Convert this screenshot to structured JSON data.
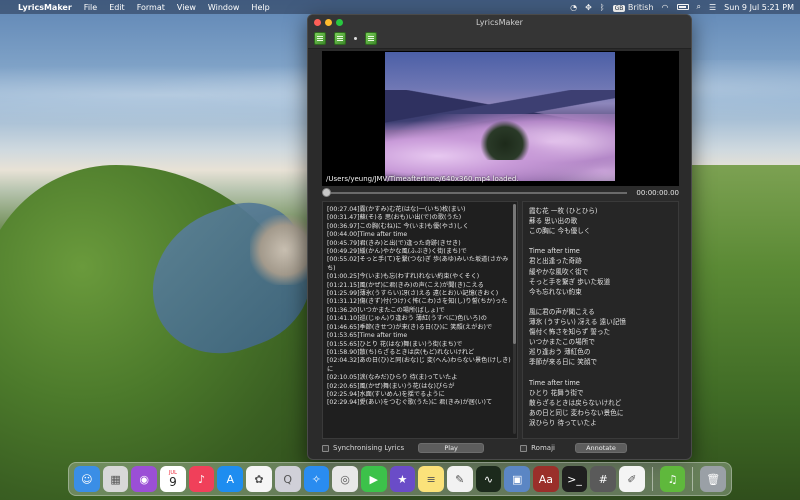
{
  "menubar": {
    "app_name": "LyricsMaker",
    "menus": [
      "File",
      "Edit",
      "Format",
      "View",
      "Window",
      "Help"
    ],
    "input_source": "British",
    "keyboard_badge": "GB",
    "date_time": "Sun 9 Jul  5:21 PM"
  },
  "window": {
    "title": "LyricsMaker",
    "status": "/Users/yeung/JMV/Timeaftertime/640x360.mp4 loaded.",
    "time": "00:00:00.00",
    "seek_fraction": 0
  },
  "lrc_lines": [
    "[00:27.04]露(かすみ)む花(はな)一(いち)枚(まい)",
    "[00:31.47]蘇(そ)る 思(おも)い出(で)の歌(うた)",
    "[00:36.97]この胸(むね)に 今(いま)も優(やさ)しく",
    "[00:44.00]Time after time",
    "[00:45.79]君(きみ)と出(で)逢った奇跡(きせき)",
    "[00:49.29]緩(かん)やかな風(ふぶき)く街(まち)で",
    "[00:55.02]そっと手(て)を繋(つな)ぎ 歩(あゆ)みいた坂道(さかみち)",
    "[01:00.25]今(いま)も忘(わすれ)れない約束(やくそく)",
    "[01:21.15]風(かぜ)に君(きみ)の声(こえ)が聞(き)こえる",
    "[01:25.99]薄氷(うすらい)冴(さ)える 遠(とお)い記憶(きおく)",
    "[01:31.12]傷(きず)付(つけ)く怖(こわ)さを知(し)り誓(ちか)った",
    "[01:36.20]いつかまたこの場所(ばしょ)で",
    "[01:41.10]巡(じゅん)り逢おう 薄紅(うすべに)色(いろ)の",
    "[01:46.65]季節(きせつ)が来(き)る日(ひ)に 笑顔(えがお)で",
    "[01:53.65]Time after time",
    "[01:55.65]ひとり 花(はな)舞(まい)う街(まち)で",
    "[01:58.90]散(ち)らざるときは戻(もど)れないけれど",
    "[02:04.32]あの日(ひ)と同(おな)じ 変(へん)わらない景色(けしき)に",
    "[02:10.05]涙(なみだ)ひらり 待(ま)っていたよ",
    "[02:20.65]風(かぜ)舞(まい)う花(はな)びらが",
    "[02:25.94]水面(すいめん)を揺でるように",
    "[02:29.94]愛(あい)をつむぐ歌(うた)に 君(きみ)が居(い)て"
  ],
  "lyric_lines": [
    "霞む花 一枚 (ひとひら)",
    "蘇る 思い出の歌",
    "この胸に 今も優しく",
    "",
    "Time after time",
    "君と出逢った奇跡",
    "緩やかな風吹く街で",
    "そっと手を繋ぎ 歩いた坂道",
    "今も忘れない約束",
    "",
    "風に君の声が聞こえる",
    "薄氷 (うすらい) 冴える 遠い記憶",
    "傷付く怖さを知らず 誓った",
    "いつかまたこの場所で",
    "巡り逢おう 薄紅色の",
    "季節が来る日に 笑顔で",
    "",
    "Time after time",
    "ひとり 花舞う街で",
    "散らざるときは戻らないけれど",
    "あの日と同じ 変わらない景色に",
    "涙ひらり 待っていたよ"
  ],
  "controls": {
    "sync_label": "Synchronising Lyrics",
    "play_label": "Play",
    "romaji_label": "Romaji",
    "annotate_label": "Annotate"
  },
  "dock": {
    "calendar_month": "JUL",
    "calendar_day": "9",
    "dictionary_glyph": "Aa",
    "apps": [
      {
        "name": "finder-icon",
        "color": "#3a8ee6",
        "glyph": "☺"
      },
      {
        "name": "launchpad-icon",
        "color": "#d8d8d8",
        "glyph": "▦"
      },
      {
        "name": "podcasts-icon",
        "color": "#9b4fd6",
        "glyph": "◉"
      },
      {
        "name": "calendar-icon",
        "color": "#ffffff",
        "glyph": ""
      },
      {
        "name": "music-icon",
        "color": "#f0405a",
        "glyph": "♪"
      },
      {
        "name": "app-store-icon",
        "color": "#1e8df0",
        "glyph": "A"
      },
      {
        "name": "photos-icon",
        "color": "#f6f6f6",
        "glyph": "✿"
      },
      {
        "name": "quicktime-icon",
        "color": "#d0d0d8",
        "glyph": "Q"
      },
      {
        "name": "safari-icon",
        "color": "#2a8cf0",
        "glyph": "✧"
      },
      {
        "name": "chrome-icon",
        "color": "#e8e8e8",
        "glyph": "◎"
      },
      {
        "name": "facetime-icon",
        "color": "#3cc24a",
        "glyph": "▶"
      },
      {
        "name": "imovie-icon",
        "color": "#6a4cc8",
        "glyph": "★"
      },
      {
        "name": "notes-icon",
        "color": "#fbe27a",
        "glyph": "≡"
      },
      {
        "name": "pages-icon",
        "color": "#f2f2f2",
        "glyph": "✎"
      },
      {
        "name": "activity-monitor-icon",
        "color": "#1c2a1c",
        "glyph": "∿"
      },
      {
        "name": "preview-icon",
        "color": "#5b86c4",
        "glyph": "▣"
      },
      {
        "name": "dictionary-icon",
        "color": "#9a2f2a",
        "glyph": ""
      },
      {
        "name": "terminal-icon",
        "color": "#1f1f1f",
        "glyph": ">_"
      },
      {
        "name": "calculator-icon",
        "color": "#5a5a5a",
        "glyph": "#"
      },
      {
        "name": "textedit-icon",
        "color": "#f4f4f4",
        "glyph": "✐"
      }
    ],
    "running": [
      {
        "name": "lyricsmaker-dock-icon",
        "color": "#5fb83c",
        "glyph": "♫"
      }
    ],
    "trash": {
      "name": "trash-icon",
      "color": "#9aa0a6",
      "glyph": "🗑"
    }
  }
}
